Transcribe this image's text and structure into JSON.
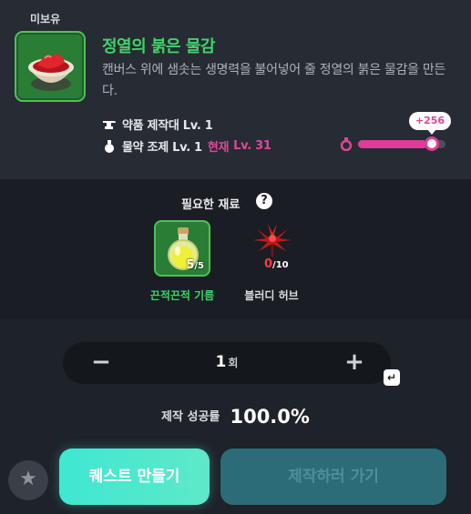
{
  "recipe": {
    "status_label": "미보유",
    "title": "정열의 붉은 물감",
    "description": "캔버스 위에 샘솟는 생명력을 불어넣어 줄 정열의 붉은 물감을 만든다.",
    "requirement_1": {
      "icon": "anvil-icon",
      "label": "약품 제작대 Lv. 1"
    },
    "requirement_2": {
      "icon": "potion-flask-icon",
      "label": "물약 조제 Lv. 1",
      "current_label": "현재",
      "current_value": "Lv. 31"
    },
    "exp_gain": "+256",
    "exp_progress": 0.78
  },
  "materials": {
    "title": "필요한 재료",
    "help_icon": "?",
    "items": [
      {
        "name": "끈적끈적 기름",
        "have": "5",
        "need": "/5",
        "icon": "oil-bottle-icon"
      },
      {
        "name": "블러디 허브",
        "have": "0",
        "need": "/10",
        "icon": "red-herb-icon"
      }
    ]
  },
  "quantity": {
    "minus": "−",
    "value": "1",
    "unit": "회",
    "plus": "+",
    "enter_icon": "↵"
  },
  "success": {
    "label": "제작 성공률",
    "value": "100.0%"
  },
  "buttons": {
    "favorite_icon": "★",
    "quest": "퀘스트 만들기",
    "go": "제작하러 가기"
  },
  "colors": {
    "title_green": "#3fd36a",
    "accent_pink": "#e0459a",
    "quest_cyan": "#3fe7d2",
    "go_teal": "#2b6c78"
  }
}
